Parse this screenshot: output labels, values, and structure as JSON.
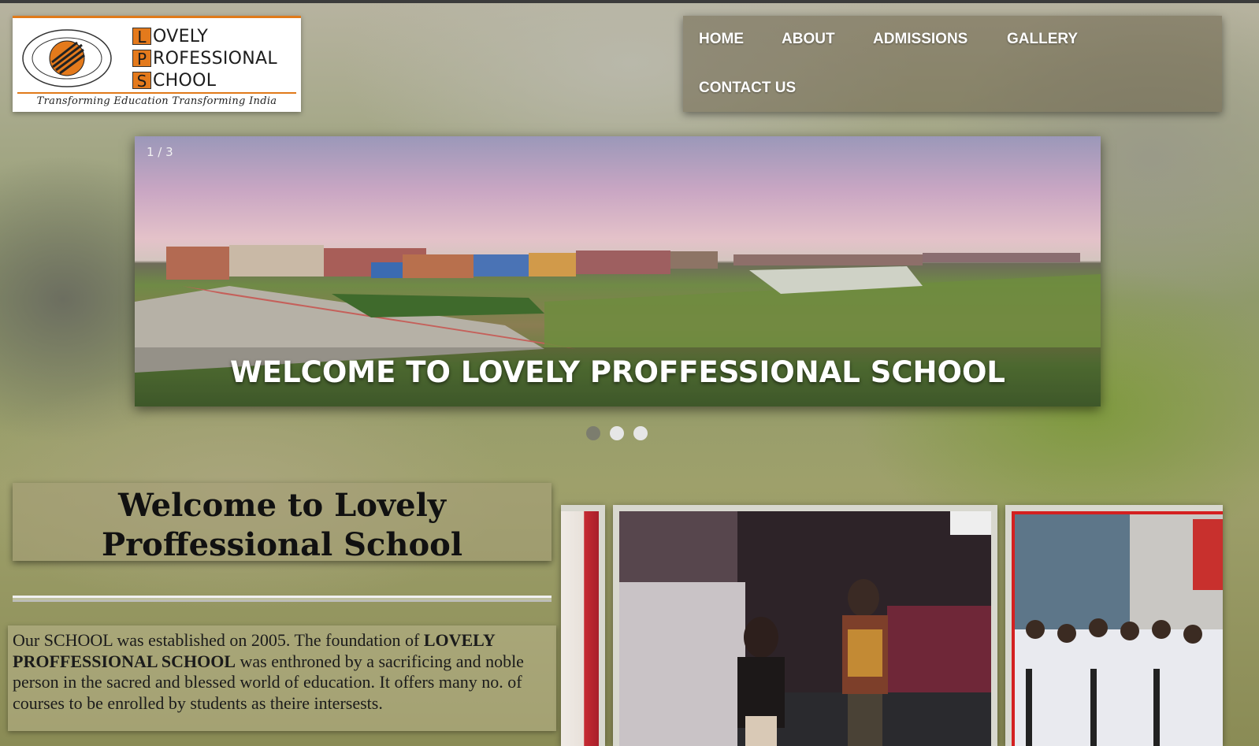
{
  "logo": {
    "letters": [
      "L",
      "P",
      "S"
    ],
    "rest": [
      "OVELY",
      "ROFESSIONAL",
      "CHOOL"
    ],
    "seal_text": [
      "PROFESSIONAL",
      "LOVELY",
      "SCHOOL",
      "PUNJAB (INDIA)"
    ],
    "tagline": "Transforming Education Transforming India"
  },
  "nav": {
    "items": [
      "HOME",
      "ABOUT",
      "ADMISSIONS",
      "GALLERY",
      "CONTACT US"
    ]
  },
  "slider": {
    "counter": "1 / 3",
    "caption": "WELCOME TO LOVELY PROFFESSIONAL SCHOOL",
    "total_slides": 3,
    "active_slide": 1
  },
  "welcome": {
    "heading": "Welcome to Lovely Proffessional School"
  },
  "about": {
    "t1": "Our SCHOOL was established on 2005. The foundation of ",
    "b1": "LOVELY PROFFESSIONAL SCHOOL",
    "t2": " was enthroned by a sacrificing and noble person in the sacred and blessed world of education. It offers many no. of courses to be enrolled by students as theire intersests."
  },
  "colors": {
    "accent_orange": "#e47a1c",
    "nav_text": "#ffffff",
    "frame_red": "#d42020"
  }
}
